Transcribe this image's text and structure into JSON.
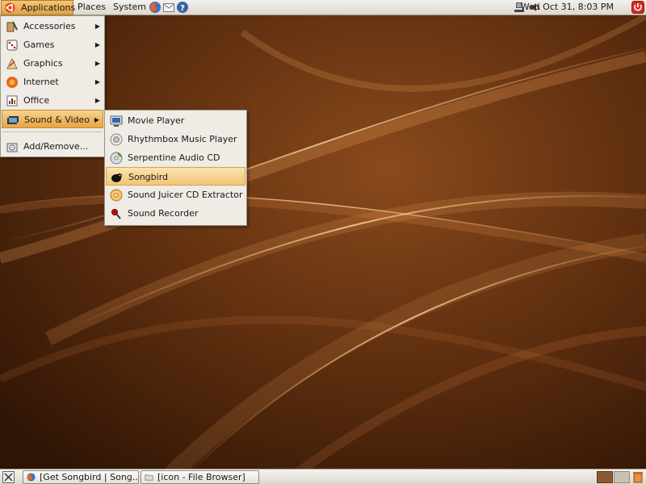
{
  "top_panel": {
    "menus": {
      "applications": "Applications",
      "places": "Places",
      "system": "System"
    },
    "clock": "Wed Oct 31,  8:03 PM"
  },
  "applications_menu": {
    "items": [
      {
        "label": "Accessories",
        "icon": "accessories-icon"
      },
      {
        "label": "Games",
        "icon": "games-icon"
      },
      {
        "label": "Graphics",
        "icon": "graphics-icon"
      },
      {
        "label": "Internet",
        "icon": "internet-icon"
      },
      {
        "label": "Office",
        "icon": "office-icon"
      },
      {
        "label": "Sound & Video",
        "icon": "sound-video-icon"
      }
    ],
    "add_remove": "Add/Remove..."
  },
  "sound_video_submenu": {
    "items": [
      {
        "label": "Movie Player",
        "icon": "movie-player-icon"
      },
      {
        "label": "Rhythmbox Music Player",
        "icon": "rhythmbox-icon"
      },
      {
        "label": "Serpentine Audio CD Creator",
        "icon": "cd-creator-icon"
      },
      {
        "label": "Songbird",
        "icon": "songbird-icon"
      },
      {
        "label": "Sound Juicer CD Extractor",
        "icon": "cd-extractor-icon"
      },
      {
        "label": "Sound Recorder",
        "icon": "microphone-icon"
      }
    ]
  },
  "taskbar": {
    "tasks": [
      {
        "label": "[Get Songbird | Song...",
        "icon": "firefox-icon"
      },
      {
        "label": "[icon - File Browser]",
        "icon": "folder-icon"
      }
    ]
  },
  "colors": {
    "accent": "#e6a542",
    "panel": "#e8e5df",
    "desktop": "#5a2e10"
  }
}
